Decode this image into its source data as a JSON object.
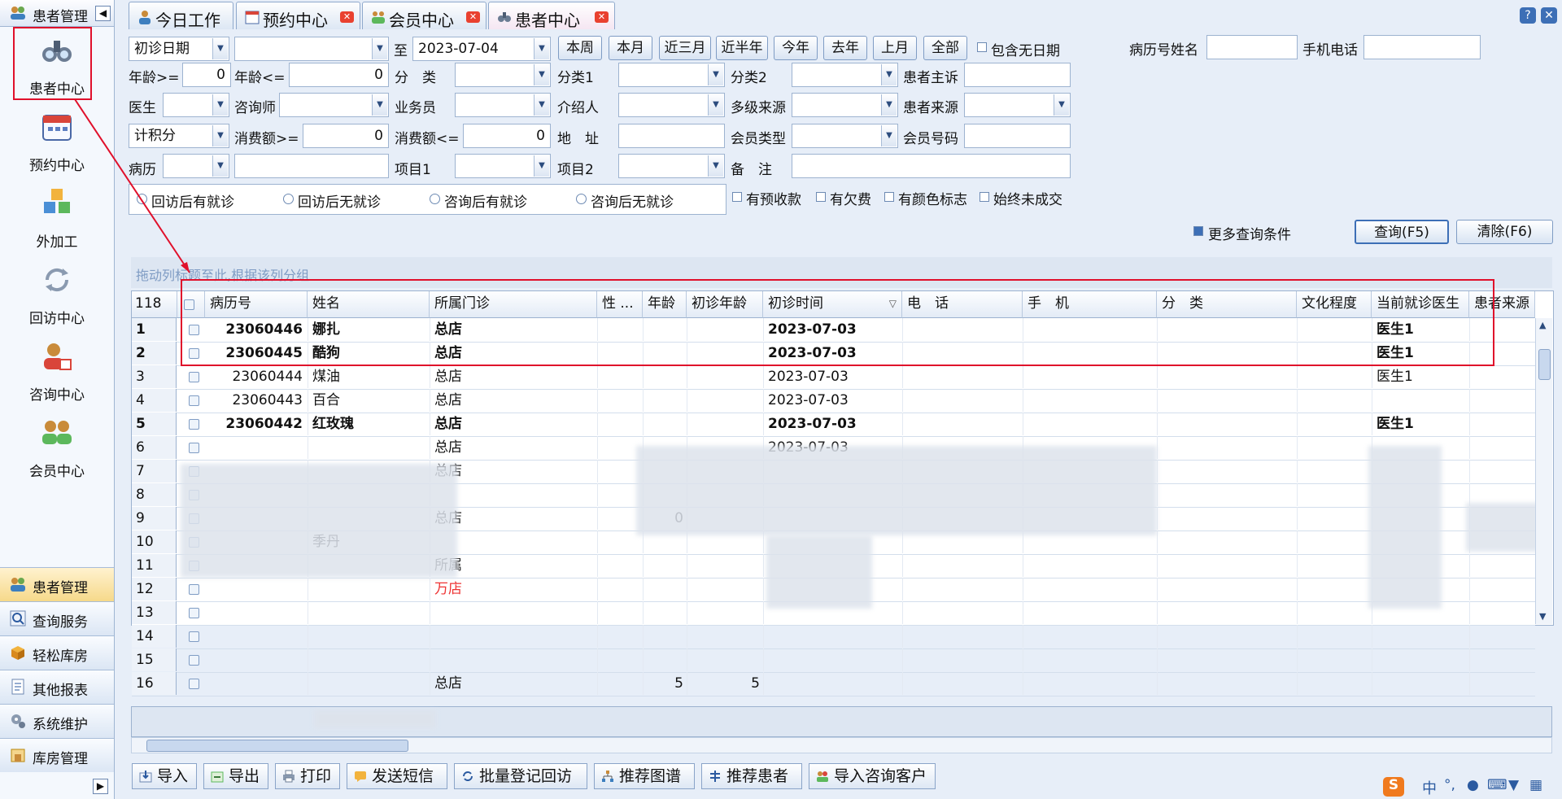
{
  "sidebar": {
    "title": "患者管理",
    "items": [
      {
        "label": "患者中心",
        "icon": "binoculars-icon"
      },
      {
        "label": "预约中心",
        "icon": "calendar-icon"
      },
      {
        "label": "外加工",
        "icon": "cubes-icon"
      },
      {
        "label": "回访中心",
        "icon": "refresh-icon"
      },
      {
        "label": "咨询中心",
        "icon": "consult-user-icon"
      },
      {
        "label": "会员中心",
        "icon": "members-icon"
      }
    ],
    "groups": [
      "患者管理",
      "查询服务",
      "轻松库房",
      "其他报表",
      "系统维护",
      "库房管理"
    ]
  },
  "tabs": [
    {
      "label": "今日工作",
      "icon": "user-icon",
      "closable": false
    },
    {
      "label": "预约中心",
      "icon": "calendar-icon",
      "closable": true
    },
    {
      "label": "会员中心",
      "icon": "members-icon",
      "closable": true
    },
    {
      "label": "患者中心",
      "icon": "binoculars-icon",
      "closable": true,
      "active": true
    }
  ],
  "filters": {
    "date_type": "初诊日期",
    "date_from": "",
    "to_label": "至",
    "date_to": "2023-07-04",
    "quick_buttons": [
      "本周",
      "本月",
      "近三月",
      "近半年",
      "今年",
      "去年",
      "上月",
      "全部"
    ],
    "include_no_date": "包含无日期",
    "record_name_label": "病历号姓名",
    "mobile_label": "手机电话",
    "age_min_label": "年龄>=",
    "age_min": "0",
    "age_max_label": "年龄<=",
    "age_max": "0",
    "category_label": "分　类",
    "category1_label": "分类1",
    "category2_label": "分类2",
    "complaint_label": "患者主诉",
    "doctor_label": "医生",
    "consultant_label": "咨询师",
    "salesman_label": "业务员",
    "referrer_label": "介绍人",
    "multi_source_label": "多级来源",
    "patient_source_label": "患者来源",
    "points_type": "计积分",
    "spend_min_label": "消费额>=",
    "spend_min": "0",
    "spend_max_label": "消费额<=",
    "spend_max": "0",
    "address_label": "地　址",
    "member_type_label": "会员类型",
    "member_no_label": "会员号码",
    "record_type": "病历",
    "project1_label": "项目1",
    "project2_label": "项目2",
    "remark_label": "备　注",
    "radios": [
      "回访后有就诊",
      "回访后无就诊",
      "咨询后有就诊",
      "咨询后无就诊"
    ],
    "checks": [
      "有预收款",
      "有欠费",
      "有颜色标志",
      "始终未成交"
    ],
    "more_conditions": "更多查询条件",
    "query_btn": "查询(F5)",
    "clear_btn": "清除(F6)"
  },
  "grid": {
    "group_hint": "拖动列标题至此,根据该列分组",
    "count": "118",
    "columns": [
      "病历号",
      "姓名",
      "所属门诊",
      "性 ...",
      "年龄",
      "初诊年龄",
      "初诊时间",
      "电　话",
      "手　机",
      "分　类",
      "文化程度",
      "当前就诊医生",
      "患者来源"
    ],
    "rows": [
      {
        "num": "1",
        "id": "23060446",
        "name": "娜扎",
        "clinic": "总店",
        "age": "",
        "first_age": "",
        "date": "2023-07-03",
        "doctor": "医生1",
        "bold": true,
        "current": true
      },
      {
        "num": "2",
        "id": "23060445",
        "name": "酷狗",
        "clinic": "总店",
        "age": "",
        "first_age": "",
        "date": "2023-07-03",
        "doctor": "医生1",
        "bold": true
      },
      {
        "num": "3",
        "id": "23060444",
        "name": "煤油",
        "clinic": "总店",
        "age": "",
        "first_age": "",
        "date": "2023-07-03",
        "doctor": "医生1"
      },
      {
        "num": "4",
        "id": "23060443",
        "name": "百合",
        "clinic": "总店",
        "age": "",
        "first_age": "",
        "date": "2023-07-03",
        "doctor": ""
      },
      {
        "num": "5",
        "id": "23060442",
        "name": "红玫瑰",
        "clinic": "总店",
        "age": "",
        "first_age": "",
        "date": "2023-07-03",
        "doctor": "医生1",
        "bold": true
      },
      {
        "num": "6",
        "id": "",
        "name": "",
        "clinic": "总店",
        "age": "",
        "first_age": "",
        "date": "2023-07-03",
        "doctor": ""
      },
      {
        "num": "7",
        "id": "",
        "name": "",
        "clinic": "总店",
        "age": "",
        "first_age": "",
        "date": "",
        "doctor": ""
      },
      {
        "num": "8",
        "id": "",
        "name": "",
        "clinic": "",
        "age": "",
        "first_age": "",
        "date": "",
        "doctor": ""
      },
      {
        "num": "9",
        "id": "",
        "name": "",
        "clinic": "总店",
        "age": "0",
        "first_age": "",
        "date": "",
        "doctor": ""
      },
      {
        "num": "10",
        "id": "",
        "name": "季丹",
        "clinic": "",
        "age": "",
        "first_age": "",
        "date": "",
        "doctor": ""
      },
      {
        "num": "11",
        "id": "",
        "name": "",
        "clinic": "所属",
        "age": "",
        "first_age": "",
        "date": "",
        "doctor": ""
      },
      {
        "num": "12",
        "id": "",
        "name": "",
        "clinic": "万店",
        "age": "",
        "first_age": "",
        "date": "",
        "doctor": "",
        "red": true
      },
      {
        "num": "13",
        "id": "",
        "name": "",
        "clinic": "",
        "age": "",
        "first_age": "",
        "date": "",
        "doctor": ""
      },
      {
        "num": "14",
        "id": "",
        "name": "",
        "clinic": "",
        "age": "",
        "first_age": "",
        "date": "",
        "doctor": ""
      },
      {
        "num": "15",
        "id": "",
        "name": "",
        "clinic": "",
        "age": "",
        "first_age": "",
        "date": "",
        "doctor": ""
      },
      {
        "num": "16",
        "id": "",
        "name": "",
        "clinic": "总店",
        "age": "5",
        "first_age": "5",
        "date": "",
        "doctor": ""
      }
    ]
  },
  "toolbar": [
    "导入",
    "导出",
    "打印",
    "发送短信",
    "批量登记回访",
    "推荐图谱",
    "推荐患者",
    "导入咨询客户"
  ],
  "colors": {
    "accent": "#2b5aa0",
    "highlight_box": "#e0102b",
    "red_row": "#ee3333"
  }
}
